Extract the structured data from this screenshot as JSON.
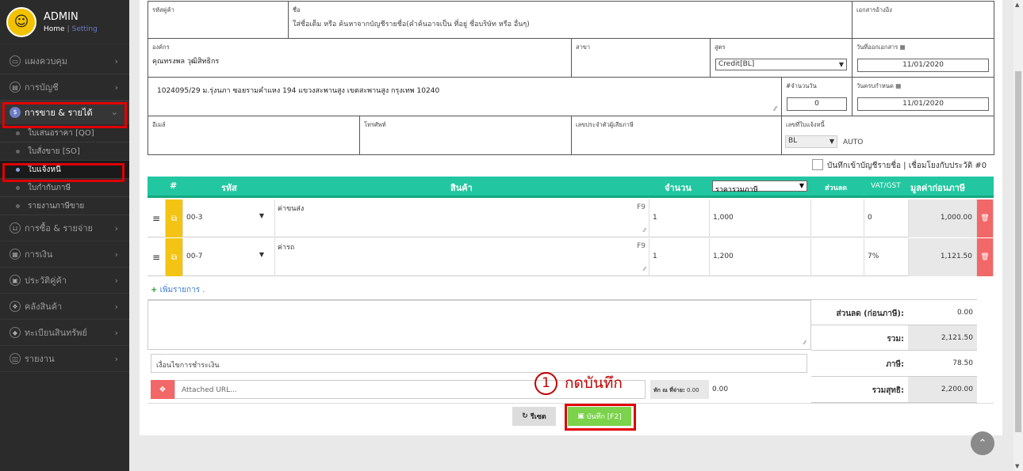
{
  "sidebar": {
    "user_name": "ADMIN",
    "link_home": "Home",
    "link_sep": "|",
    "link_setting": "Setting",
    "menu": [
      {
        "label": "แผงควบคุม",
        "icon": "monitor-icon"
      },
      {
        "label": "การบัญชี",
        "icon": "book-icon"
      },
      {
        "label": "การขาย & รายได้",
        "icon": "dollar-icon",
        "active": true
      },
      {
        "label": "การซื้อ & รายจ่าย",
        "icon": "cart-icon"
      },
      {
        "label": "การเงิน",
        "icon": "calendar-icon"
      },
      {
        "label": "ประวัติคู่ค้า",
        "icon": "contact-icon"
      },
      {
        "label": "คลังสินค้า",
        "icon": "cubes-icon"
      },
      {
        "label": "ทะเบียนสินทรัพย์",
        "icon": "diamond-icon"
      },
      {
        "label": "รายงาน",
        "icon": "report-icon"
      }
    ],
    "submenu": [
      "ใบเสนอราคา [QO]",
      "ใบสั่งขาย [SO]",
      "ใบแจ้งหนี้",
      "ใบกำกับภาษี",
      "รายงานภาษีขาย"
    ]
  },
  "form": {
    "customer_code_label": "รหัสคู่ค้า",
    "name_label": "ชื่อ",
    "name_placeholder": "ใส่ชื่อเต็ม หรือ ค้นหาจากบัญชีรายชื่อ(คำค้นอาจเป็น ที่อยู่ ชื่อบริษัท หรือ อื่นๆ)",
    "reference_label": "เอกสารอ้างอิง",
    "org_label": "องค์กร",
    "org_value": "คุณทรงพล วุฒิสิทธิกร",
    "branch_label": "สาขา",
    "formula_label": "สูตร",
    "formula_value": "Credit[BL]",
    "issue_date_label": "วันที่ออกเอกสาร",
    "issue_date_value": "11/01/2020",
    "address_value": "1024095/29 ม.รุ่งนภา ซอยรามคำแหง 194 แขวงสะพานสูง เขตสะพานสูง กรุงเทพ 10240",
    "days_label": "#จำนวนวัน",
    "days_value": "0",
    "due_date_label": "วันครบกำหนด",
    "due_date_value": "11/01/2020",
    "email_label": "อีเมล์",
    "phone_label": "โทรศัพท์",
    "taxid_label": "เลขประจำตัวผู้เสียภาษี",
    "invoice_no_label": "เลขที่ใบแจ้งหนี้",
    "invoice_prefix": "BL",
    "invoice_auto": "AUTO"
  },
  "save_to_contacts": "บันทึกเข้าบัญชีรายชื่อ | เชื่อมโยงกับประวัติ #0",
  "table": {
    "headers": {
      "num": "#",
      "code": "รหัส",
      "product": "สินค้า",
      "qty": "จำนวน",
      "price_select": "ราคารวมภาษี",
      "discount": "ส่วนลด",
      "vat": "VAT/GST",
      "pretax": "มูลค่าก่อนภาษี"
    },
    "rows": [
      {
        "code": "00-3",
        "product": "ค่าขนส่ง",
        "hotkey": "F9",
        "qty": "1",
        "price": "1,000",
        "vat": "0",
        "amount": "1,000.00"
      },
      {
        "code": "00-7",
        "product": "ค่ารถ",
        "hotkey": "F9",
        "qty": "1",
        "price": "1,200",
        "vat": "7%",
        "amount": "1,121.50"
      }
    ],
    "add_item": "เพิ่มรายการ ."
  },
  "totals": {
    "discount_label": "ส่วนลด (ก่อนภาษี):",
    "discount_value": "0.00",
    "sum_label": "รวม:",
    "sum_value": "2,121.50",
    "tax_label": "ภาษี:",
    "tax_value": "78.50",
    "net_label": "รวมสุทธิ:",
    "net_value": "2,200.00"
  },
  "payment_terms_placeholder": "เงื่อนไขการชำระเงิน",
  "attach_placeholder": "Attached URL...",
  "withholding_label": "หัก ณ ที่จ่าย:",
  "withholding_small": "0.00",
  "withholding_value": "0.00",
  "buttons": {
    "reset": "รีเซต",
    "save": "บันทึก [F2]"
  },
  "annotation": {
    "number": "1",
    "text": "กดบันทึก"
  },
  "colors": {
    "accent": "#22c7a1",
    "save": "#7ad34a",
    "highlight": "#e00000"
  }
}
